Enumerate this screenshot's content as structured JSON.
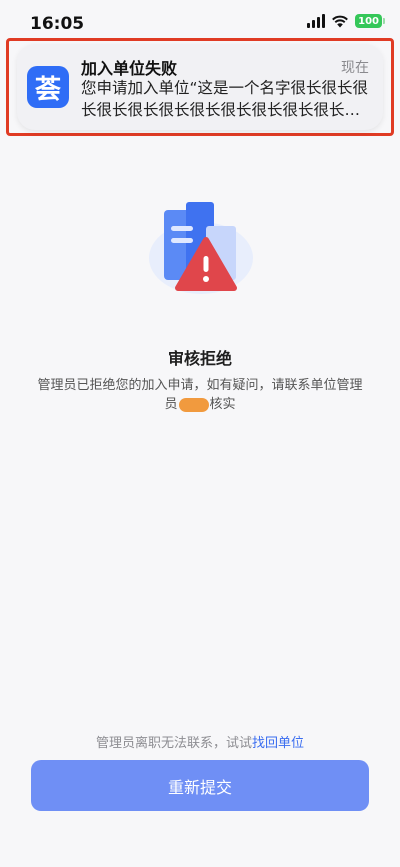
{
  "status_bar": {
    "time": "16:05",
    "battery": "100"
  },
  "notification": {
    "app_icon_glyph": "荟",
    "title": "加入单位失败",
    "time": "现在",
    "body": "您申请加入单位“这是一个名字很长很长很长很长很长很长很长很长很长很长很长很长"
  },
  "result": {
    "title": "审核拒绝",
    "desc_line1": "管理员已拒绝您的加入申请，如有疑问，请联系单位管理",
    "desc_line2_prefix": "员",
    "desc_line2_suffix": "核实"
  },
  "footer": {
    "help_text": "管理员离职无法联系，试试",
    "help_link": "找回单位",
    "submit_label": "重新提交"
  },
  "colors": {
    "primary": "#6f8ff5",
    "link": "#3a6df0",
    "alert": "#e0464b",
    "highlight_border": "#e03b24"
  }
}
